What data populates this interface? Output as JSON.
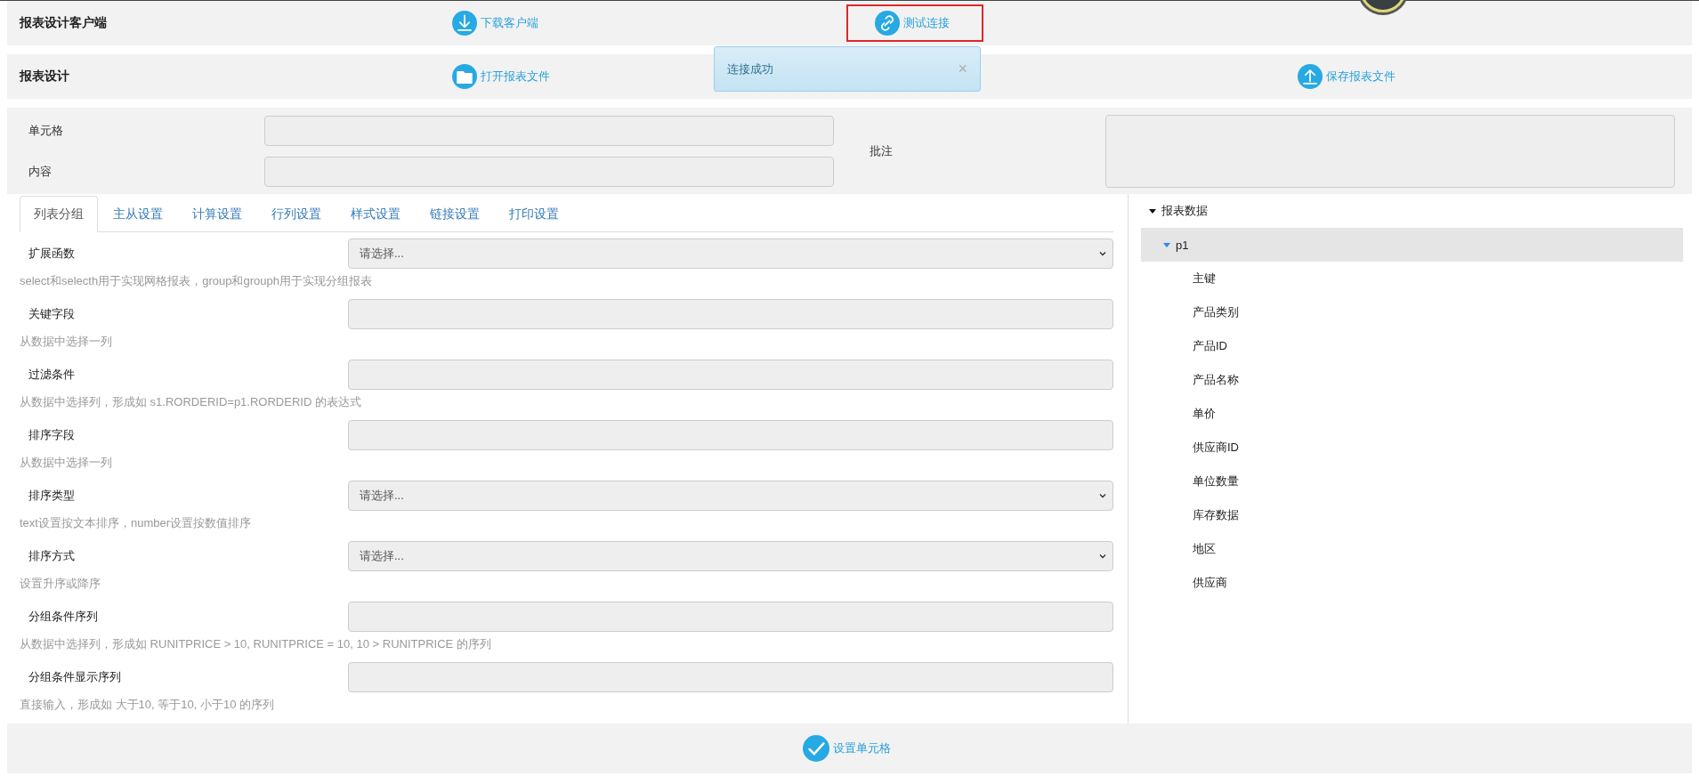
{
  "header_bars": [
    {
      "title": "报表设计客户端",
      "actions": [
        {
          "kind": "download",
          "label": "下载客户端",
          "focused": false
        },
        {
          "kind": "link",
          "label": "测试连接",
          "focused": true
        }
      ]
    },
    {
      "title": "报表设计",
      "actions": [
        {
          "kind": "folder",
          "label": "打开报表文件",
          "focused": false
        },
        {
          "kind": "upload",
          "label": "保存报表文件",
          "focused": false
        }
      ]
    }
  ],
  "toast": {
    "message": "连接成功",
    "close": "×"
  },
  "cell_panel": {
    "cell_label": "单元格",
    "content_label": "内容",
    "note_label": "批注"
  },
  "tabs": [
    {
      "label": "列表分组",
      "selected": true
    },
    {
      "label": "主从设置",
      "selected": false
    },
    {
      "label": "计算设置",
      "selected": false
    },
    {
      "label": "行列设置",
      "selected": false
    },
    {
      "label": "样式设置",
      "selected": false
    },
    {
      "label": "链接设置",
      "selected": false
    },
    {
      "label": "打印设置",
      "selected": false
    }
  ],
  "fields": [
    {
      "label": "扩展函数",
      "kind": "select",
      "value": "请选择...",
      "help": "select和selecth用于实现网格报表，group和grouph用于实现分组报表"
    },
    {
      "label": "关键字段",
      "kind": "text",
      "help": "从数据中选择一列"
    },
    {
      "label": "过滤条件",
      "kind": "text",
      "help": "从数据中选择列，形成如 s1.RORDERID=p1.RORDERID 的表达式"
    },
    {
      "label": "排序字段",
      "kind": "text",
      "help": "从数据中选择一列"
    },
    {
      "label": "排序类型",
      "kind": "select",
      "value": "请选择...",
      "help": "text设置按文本排序，number设置按数值排序"
    },
    {
      "label": "排序方式",
      "kind": "select",
      "value": "请选择...",
      "help": "设置升序或降序"
    },
    {
      "label": "分组条件序列",
      "kind": "text",
      "help": "从数据中选择列，形成如 RUNITPRICE > 10, RUNITPRICE = 10, 10 > RUNITPRICE 的序列"
    },
    {
      "label": "分组条件显示序列",
      "kind": "text",
      "help": "直接输入，形成如 大于10, 等于10, 小于10 的序列"
    }
  ],
  "tree": [
    {
      "label": "报表数据",
      "expanded": true,
      "selected": false,
      "children": [
        {
          "label": "p1",
          "expanded": true,
          "selected": true,
          "children": [
            {
              "label": "主键",
              "selected": false
            },
            {
              "label": "产品类别",
              "selected": false
            },
            {
              "label": "产品ID",
              "selected": false
            },
            {
              "label": "产品名称",
              "selected": false
            },
            {
              "label": "单价",
              "selected": false
            },
            {
              "label": "供应商ID",
              "selected": false
            },
            {
              "label": "单位数量",
              "selected": false
            },
            {
              "label": "库存数据",
              "selected": false
            },
            {
              "label": "地区",
              "selected": false
            },
            {
              "label": "供应商",
              "selected": false
            }
          ]
        }
      ]
    }
  ],
  "footer_button": {
    "label": "设置单元格"
  }
}
